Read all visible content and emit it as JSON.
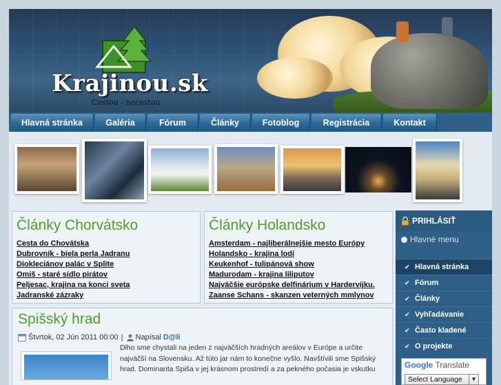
{
  "site": {
    "logo_title": "Krajinou.sk",
    "logo_subtitle": "Cestou - necestou"
  },
  "nav": {
    "items": [
      {
        "label": "Hlavná stránka"
      },
      {
        "label": "Galéria"
      },
      {
        "label": "Fórum"
      },
      {
        "label": "Články"
      },
      {
        "label": "Fotoblog"
      },
      {
        "label": "Registrácia"
      },
      {
        "label": "Kontakt"
      }
    ]
  },
  "box_croatia": {
    "title": "Články Chorvátsko",
    "links": [
      "Cesta do Chovátska",
      "Dubrovník - biela perla Jadranu",
      "Diokleciánov palác v Splite",
      "Omiš - staré sídlo pirátov",
      "Peljesac, krajina na konci sveta",
      "Jadranské zázraky"
    ]
  },
  "box_holland": {
    "title": "Články Holandsko",
    "links": [
      "Amsterdam - najliberálnejšie mesto Európy",
      "Holandsko - krajina lodí",
      "Keukenhof - tulipánová show",
      "Madurodam - krajina liliputov",
      "Najväčšie európske delfinárium v Hardervijku.",
      "Zaanse Schans - skanzen veterných mmlynov"
    ]
  },
  "article": {
    "title": "Spišský hrad",
    "date": "Štvrtok, 02 Jún 2011 00:00",
    "separator": "|",
    "posted_by": "Napísal",
    "author": "D@li",
    "lines": [
      "Dlho sme chystali na jeden z najväčších hradných areálov v Európe a určite",
      "najväčší na Slovensku. Až túto jar nám to konečne vyšlo. Navštívili sme Spišský",
      "hrad. Dominanta Spiša v jej krásnom prostredí a za pekného počasia je vskutku"
    ]
  },
  "sidebar": {
    "login": "PRIHLÁSIŤ",
    "menu_title": "Hlavné menu",
    "items": [
      {
        "label": "Hlavná stránka"
      },
      {
        "label": "Fórum"
      },
      {
        "label": "Články"
      },
      {
        "label": "Vyhľadávanie"
      },
      {
        "label": "Často kladené"
      },
      {
        "label": "O projekte"
      }
    ]
  },
  "translate": {
    "google": "Google",
    "translate": "Translate",
    "select_value": "Select Language"
  },
  "colors": {
    "accent_green": "#4f9c2e",
    "nav_blue": "#2e5f86",
    "author_blue": "#2b6fa8"
  }
}
